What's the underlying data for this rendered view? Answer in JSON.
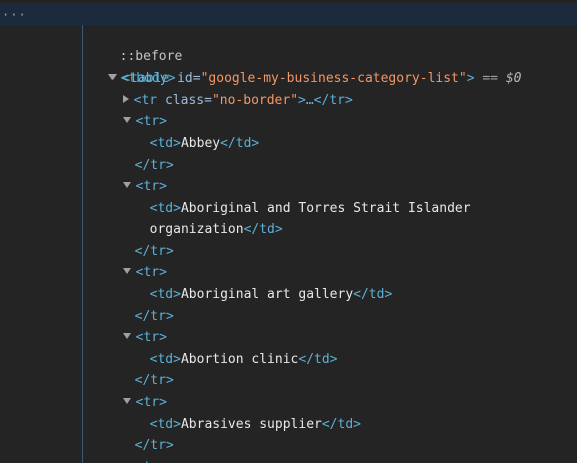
{
  "gutter": {
    "ellipsis": "···"
  },
  "table_open": {
    "open": "<table",
    "attr_name": " id=",
    "attr_value": "\"google-my-business-category-list\"",
    "close": ">",
    "equals": " == ",
    "dollar_ref": "$0"
  },
  "before": "::before",
  "tbody_open": "<tbody>",
  "collapsed_row": {
    "open": "<tr",
    "attr_name": " class=",
    "attr_value": "\"no-border\"",
    "close": ">…</tr>"
  },
  "tr_open": "<tr>",
  "tr_close": "</tr>",
  "td_open": "<td>",
  "td_close": "</td>",
  "cells": {
    "c1": "Abbey",
    "c2_line1": "Aboriginal and Torres Strait Islander",
    "c2_line2": "organization",
    "c3": "Aboriginal art gallery",
    "c4": "Abortion clinic",
    "c5": "Abrasives supplier"
  }
}
